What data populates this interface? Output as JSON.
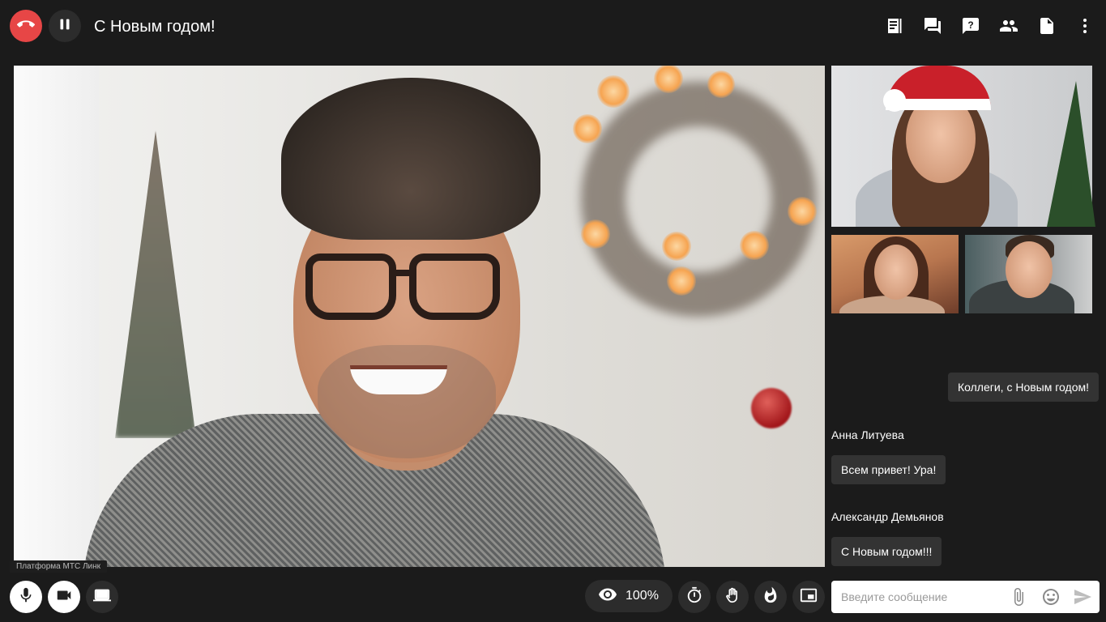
{
  "header": {
    "title": "С Новым годом!"
  },
  "chat": {
    "messages": [
      {
        "sender": "",
        "text": "Коллеги, с Новым годом!"
      },
      {
        "sender": "Анна Литуева",
        "text": "Всем привет! Ура!"
      },
      {
        "sender": "Александр Демьянов",
        "text": "С Новым годом!!!"
      }
    ],
    "input_placeholder": "Введите сообщение"
  },
  "toolbar": {
    "zoom_label": "100%"
  },
  "watermark": "Платформа МТС Линк",
  "colors": {
    "hangup": "#e74646",
    "background": "#1b1b1b",
    "button": "#2c2c2c",
    "bubble": "#333333"
  },
  "icons": {
    "top": [
      "notes-icon",
      "chat-icon",
      "help-icon",
      "participants-icon",
      "file-icon",
      "more-icon"
    ],
    "bottom_left": [
      "microphone-icon",
      "camera-icon",
      "screen-share-icon"
    ],
    "bottom_right": [
      "eye-icon",
      "timer-icon",
      "raise-hand-icon",
      "fire-reaction-icon",
      "picture-in-picture-icon"
    ],
    "chat_input": [
      "attach-icon",
      "emoji-icon",
      "send-icon"
    ]
  }
}
